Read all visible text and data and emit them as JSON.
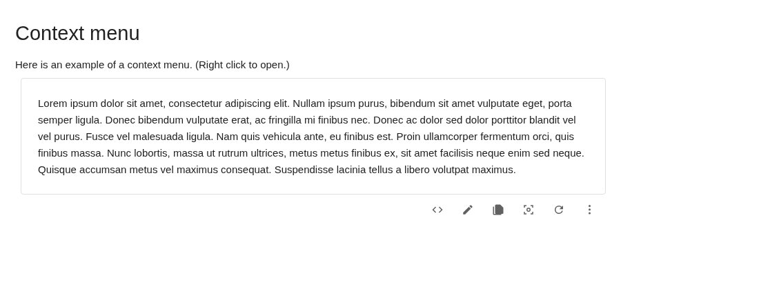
{
  "title": "Context menu",
  "intro": "Here is an example of a context menu. (Right click to open.)",
  "card": {
    "text": "Lorem ipsum dolor sit amet, consectetur adipiscing elit. Nullam ipsum purus, bibendum sit amet vulputate eget, porta semper ligula. Donec bibendum vulputate erat, ac fringilla mi finibus nec. Donec ac dolor sed dolor porttitor blandit vel vel purus. Fusce vel malesuada ligula. Nam quis vehicula ante, eu finibus est. Proin ullamcorper fermentum orci, quis finibus massa. Nunc lobortis, massa ut rutrum ultrices, metus metus finibus ex, sit amet facilisis neque enim sed neque. Quisque accumsan metus vel maximus consequat. Suspendisse lacinia tellus a libero volutpat maximus."
  }
}
